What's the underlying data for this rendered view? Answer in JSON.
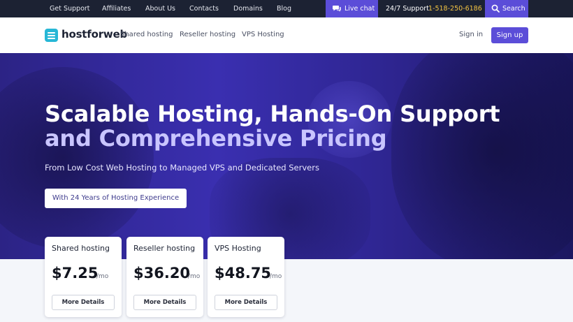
{
  "topbar": {
    "links": [
      "Get Support",
      "Affiliates",
      "About Us",
      "Contacts",
      "Domains",
      "Blog"
    ],
    "live_chat": "Live chat",
    "support_label": "24/7 Support",
    "phone": "1-518-250-6186",
    "search": "Search",
    "icons": {
      "chat": "chat-bubble-icon",
      "search": "search-icon"
    }
  },
  "nav": {
    "brand": "hostforweb",
    "links": [
      "Shared hosting",
      "Reseller hosting",
      "VPS Hosting"
    ],
    "sign_in": "Sign in",
    "sign_up": "Sign up"
  },
  "hero": {
    "title_line1": "Scalable Hosting, Hands-On Support",
    "title_line2": "and Comprehensive Pricing",
    "subtitle": "From Low Cost Web Hosting to Managed VPS and Dedicated Servers",
    "badge_button": "With 24 Years of Hosting Experience"
  },
  "plans": [
    {
      "name": "Shared hosting",
      "price": "$7.25",
      "period": "/mo",
      "button": "More Details"
    },
    {
      "name": "Reseller hosting",
      "price": "$36.20",
      "period": "/mo",
      "button": "More Details"
    },
    {
      "name": "VPS Hosting",
      "price": "$48.75",
      "period": "/mo",
      "button": "More Details"
    }
  ],
  "colors": {
    "accent": "#5b4dd8",
    "topbar_bg": "#1c2233",
    "phone": "#f4c542",
    "hero_bg": "#3a2fb0",
    "logo": "#27b7d6"
  }
}
